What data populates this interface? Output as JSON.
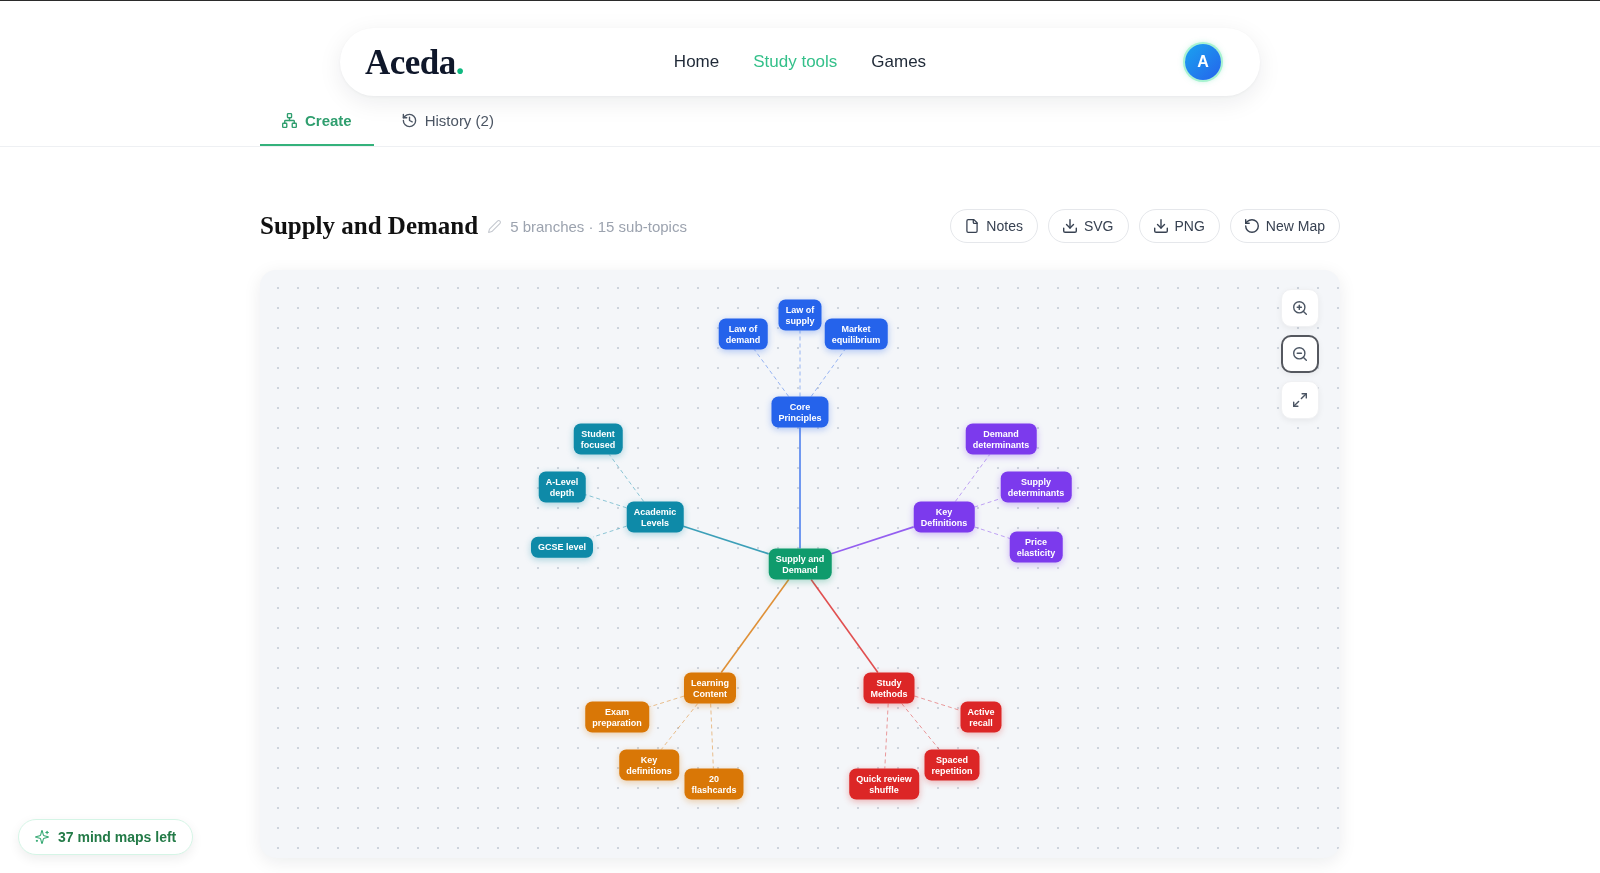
{
  "header": {
    "logo": {
      "name": "Aceda",
      "mark": "."
    },
    "nav": [
      {
        "label": "Home",
        "selected": false
      },
      {
        "label": "Study tools",
        "selected": true
      },
      {
        "label": "Games",
        "selected": false
      }
    ],
    "avatar": "A"
  },
  "tabs": [
    {
      "label": "Create",
      "kind": "create",
      "selected": true
    },
    {
      "label": "History (2)",
      "kind": "history",
      "selected": false
    }
  ],
  "map_header": {
    "title": "Supply and Demand",
    "meta": "5 branches · 15 sub-topics",
    "actions": [
      {
        "label": "Notes",
        "kind": "notes"
      },
      {
        "label": "SVG",
        "kind": "download"
      },
      {
        "label": "PNG",
        "kind": "download"
      },
      {
        "label": "New Map",
        "kind": "reset"
      }
    ]
  },
  "canvas": {
    "zoom_controls": [
      {
        "kind": "zoom-in",
        "focused": false
      },
      {
        "kind": "zoom-out",
        "focused": true
      },
      {
        "kind": "fit",
        "focused": false
      }
    ],
    "mind_map": {
      "label": "Supply and Demand",
      "color": "#0f9b6c",
      "children": [
        {
          "label": "Core Principles",
          "color": "#2563eb",
          "children": [
            {
              "label": "Law of demand"
            },
            {
              "label": "Law of supply"
            },
            {
              "label": "Market equilibrium"
            }
          ]
        },
        {
          "label": "Academic Levels",
          "color": "#0e8aa8",
          "children": [
            {
              "label": "Student focused"
            },
            {
              "label": "A-Level depth"
            },
            {
              "label": "GCSE level"
            }
          ]
        },
        {
          "label": "Key Definitions",
          "color": "#7c3aed",
          "children": [
            {
              "label": "Demand determinants"
            },
            {
              "label": "Supply determinants"
            },
            {
              "label": "Price elasticity"
            }
          ]
        },
        {
          "label": "Learning Content",
          "color": "#d97706",
          "children": [
            {
              "label": "Exam preparation"
            },
            {
              "label": "Key definitions"
            },
            {
              "label": "20 flashcards"
            }
          ]
        },
        {
          "label": "Study Methods",
          "color": "#dc2626",
          "children": [
            {
              "label": "Active recall"
            },
            {
              "label": "Spaced repetition"
            },
            {
              "label": "Quick review shuffle"
            }
          ]
        }
      ]
    }
  },
  "quota_badge": "37 mind maps left"
}
